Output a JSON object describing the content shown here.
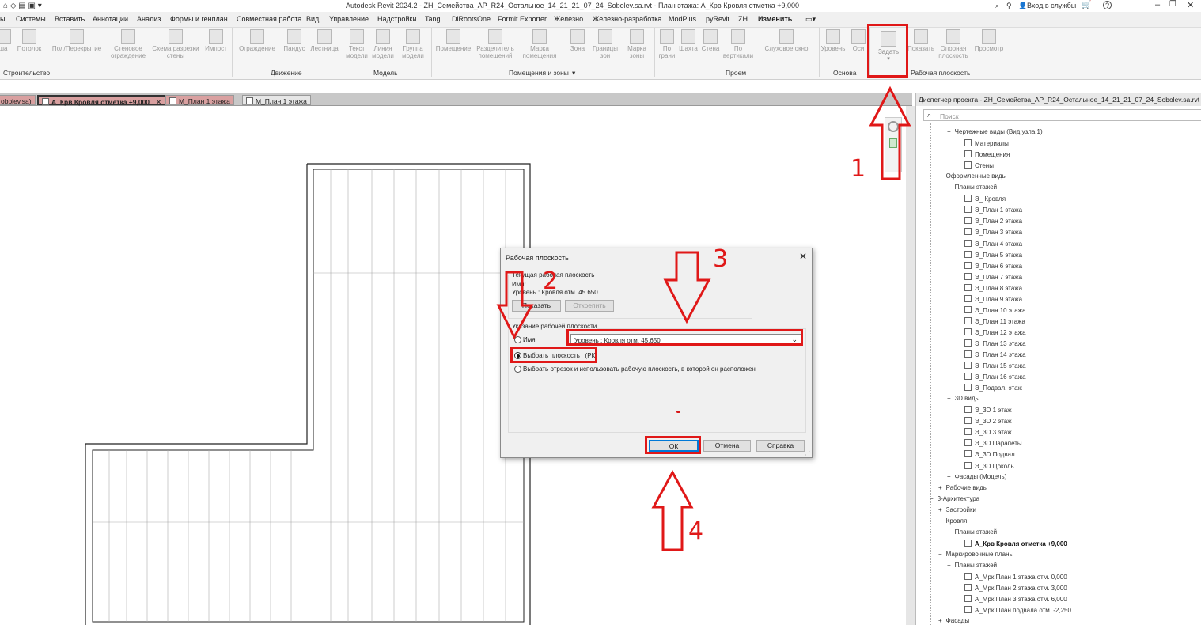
{
  "titlebar": {
    "title": "Autodesk Revit 2024.2 - ZH_Семейства_АР_R24_Остальное_14_21_21_07_24_Sobolev.sa.rvt - План этажа: А_Крв Кровля отметка +9,000",
    "signin": "Вход в службы",
    "help": "?"
  },
  "menu": [
    "ы",
    "Системы",
    "Вставить",
    "Аннотации",
    "Анализ",
    "Формы и генплан",
    "Совместная работа",
    "Вид",
    "Управление",
    "Надстройки",
    "Tangl",
    "DiRootsOne",
    "Formit Exporter",
    "Железно",
    "Железно-разработка",
    "ModPlus",
    "pyRevit",
    "ZH",
    "Изменить"
  ],
  "ribbon": {
    "tools": [
      "ша",
      "Потолок",
      "Пол/Перекрытие",
      "Стеновое ограждение",
      "Схема разрезки стены",
      "Импост",
      "Ограждение",
      "Пандус",
      "Лестница",
      "Текст модели",
      "Линия модели",
      "Группа модели",
      "Помещение",
      "Разделитель помещений",
      "Марка помещения",
      "Зона",
      "Границы зон",
      "Марка зоны",
      "По грани",
      "Шахта",
      "Стена",
      "По вертикали",
      "Слуховое окно",
      "Уровень",
      "Оси",
      "Задать",
      "Показать",
      "Опорная плоскость",
      "Просмотр"
    ],
    "panels": [
      "Строительство",
      "Движение",
      "Модель",
      "Помещения и зоны",
      "Проем",
      "Основа",
      "Рабочая плоскость"
    ]
  },
  "tabs": [
    {
      "label": "obolev.sa)",
      "active": false
    },
    {
      "label": "А_Крв Кровля отметка +9,000",
      "active": true
    },
    {
      "label": "М_План 1 этажа",
      "active": false
    },
    {
      "label": "М_План 1 этажа",
      "active": false
    }
  ],
  "browser": {
    "title": "Диспетчер проекта - ZH_Семейства_АР_R24_Остальное_14_21_21_07_24_Sobolev.sa.rvt",
    "search_placeholder": "Поиск",
    "items": [
      {
        "label": "Чертежные виды (Вид узла 1)",
        "level": 1,
        "prefix": "−"
      },
      {
        "label": "Материалы",
        "level": 3,
        "prefix": ""
      },
      {
        "label": "Помещения",
        "level": 3,
        "prefix": ""
      },
      {
        "label": "Стены",
        "level": 3,
        "prefix": ""
      },
      {
        "label": "Оформленные виды",
        "level": 0,
        "prefix": "−"
      },
      {
        "label": "Планы этажей",
        "level": 1,
        "prefix": "−"
      },
      {
        "label": "Э_ Кровля",
        "level": 3,
        "prefix": ""
      },
      {
        "label": "Э_План 1 этажа",
        "level": 3,
        "prefix": ""
      },
      {
        "label": "Э_План 2 этажа",
        "level": 3,
        "prefix": ""
      },
      {
        "label": "Э_План 3 этажа",
        "level": 3,
        "prefix": ""
      },
      {
        "label": "Э_План 4 этажа",
        "level": 3,
        "prefix": ""
      },
      {
        "label": "Э_План 5 этажа",
        "level": 3,
        "prefix": ""
      },
      {
        "label": "Э_План 6 этажа",
        "level": 3,
        "prefix": ""
      },
      {
        "label": "Э_План 7 этажа",
        "level": 3,
        "prefix": ""
      },
      {
        "label": "Э_План 8 этажа",
        "level": 3,
        "prefix": ""
      },
      {
        "label": "Э_План 9 этажа",
        "level": 3,
        "prefix": ""
      },
      {
        "label": "Э_План 10 этажа",
        "level": 3,
        "prefix": ""
      },
      {
        "label": "Э_План 11 этажа",
        "level": 3,
        "prefix": ""
      },
      {
        "label": "Э_План 12 этажа",
        "level": 3,
        "prefix": ""
      },
      {
        "label": "Э_План 13 этажа",
        "level": 3,
        "prefix": ""
      },
      {
        "label": "Э_План 14 этажа",
        "level": 3,
        "prefix": ""
      },
      {
        "label": "Э_План 15 этажа",
        "level": 3,
        "prefix": ""
      },
      {
        "label": "Э_План 16 этажа",
        "level": 3,
        "prefix": ""
      },
      {
        "label": "Э_Подвал. этаж",
        "level": 3,
        "prefix": ""
      },
      {
        "label": "3D виды",
        "level": 1,
        "prefix": "−"
      },
      {
        "label": "Э_3D 1 этаж",
        "level": 3,
        "prefix": ""
      },
      {
        "label": "Э_3D 2 этаж",
        "level": 3,
        "prefix": ""
      },
      {
        "label": "Э_3D 3 этаж",
        "level": 3,
        "prefix": ""
      },
      {
        "label": "Э_3D Парапеты",
        "level": 3,
        "prefix": ""
      },
      {
        "label": "Э_3D Подвал",
        "level": 3,
        "prefix": ""
      },
      {
        "label": "Э_3D Цоколь",
        "level": 3,
        "prefix": ""
      },
      {
        "label": "Фасады (Модель)",
        "level": 1,
        "prefix": "+"
      },
      {
        "label": "Рабочие виды",
        "level": 0,
        "prefix": "+"
      },
      {
        "label": "3-Архитектура",
        "level": -1,
        "prefix": "−"
      },
      {
        "label": "Застройки",
        "level": 0,
        "prefix": "+"
      },
      {
        "label": "Кровля",
        "level": 0,
        "prefix": "−"
      },
      {
        "label": "Планы этажей",
        "level": 1,
        "prefix": "−"
      },
      {
        "label": "А_Крв Кровля отметка +9,000",
        "level": 3,
        "prefix": "",
        "bold": true
      },
      {
        "label": "Маркировочные планы",
        "level": 0,
        "prefix": "−"
      },
      {
        "label": "Планы этажей",
        "level": 1,
        "prefix": "−"
      },
      {
        "label": "А_Мрк План 1 этажа отм. 0,000",
        "level": 3,
        "prefix": ""
      },
      {
        "label": "А_Мрк План 2 этажа отм. 3,000",
        "level": 3,
        "prefix": ""
      },
      {
        "label": "А_Мрк План 3 этажа отм. 6,000",
        "level": 3,
        "prefix": ""
      },
      {
        "label": "А_Мрк План подвала отм. -2,250",
        "level": 3,
        "prefix": ""
      },
      {
        "label": "Фасады",
        "level": 0,
        "prefix": "+"
      }
    ]
  },
  "dialog": {
    "title": "Рабочая плоскость",
    "current_group": "Текущая рабочая плоскость",
    "name_label": "Имя:",
    "current_value": "Уровень : Кровля отм. 45.650",
    "show_btn": "Показать",
    "detach_btn": "Открепить",
    "specify_group": "Указание рабочей плоскости",
    "radio_name": "Имя",
    "dropdown_value": "Уровень : Кровля отм. 45.650",
    "radio_pick": "Выбрать плоскость",
    "radio_pick_key": "(РК)",
    "radio_line": "Выбрать отрезок и использовать рабочую плоскость, в которой он расположен",
    "ok": "ОК",
    "cancel": "Отмена",
    "help": "Справка"
  },
  "annotations": [
    "1",
    "2",
    "3",
    "4"
  ],
  "colors": {
    "annotation": "#e01818",
    "active_tab": "#d9a0a0"
  }
}
